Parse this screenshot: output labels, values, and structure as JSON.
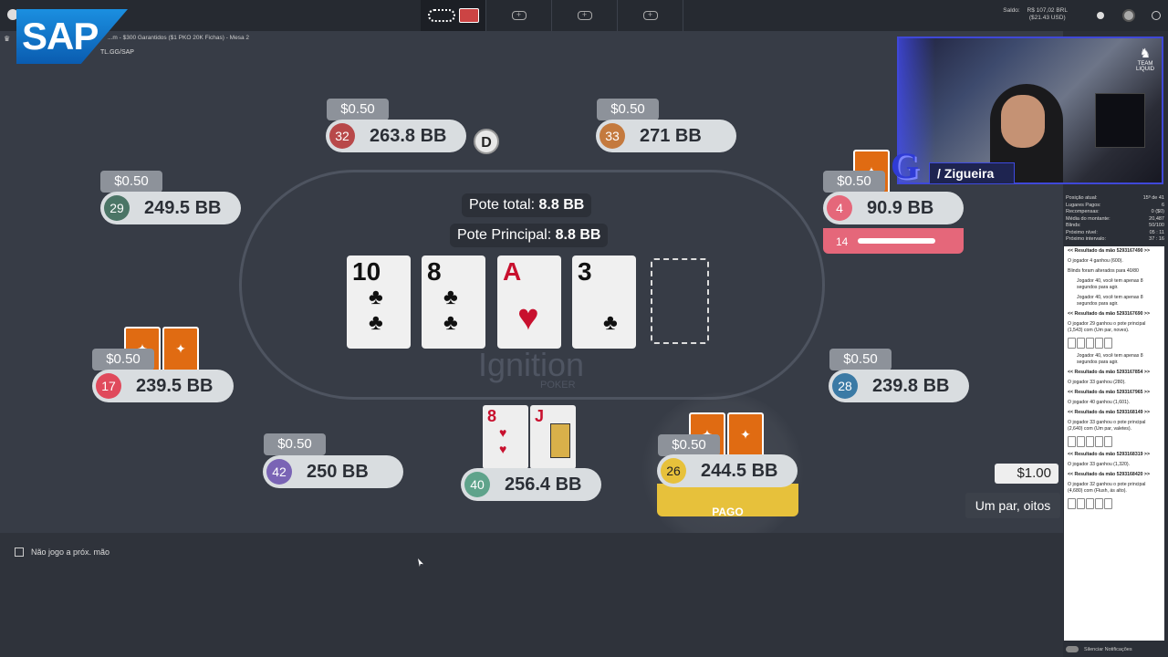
{
  "header": {
    "saldo_label": "Saldo:",
    "saldo_brl": "R$ 107,02 BRL",
    "saldo_usd": "($21.43 USD)",
    "table_title": "...m - $300 Garantidos ($1 PKO 20K Fichas) - Mesa 2",
    "brand_tag": "TL.GG/SAP"
  },
  "overlay": {
    "sap_logo": "SAP",
    "streamer_name": "/ Zigueira",
    "team_logo_text": "TEAM LIQUID"
  },
  "table": {
    "brand": "Ignition",
    "brand_sub": "POKER",
    "pot_total_label": "Pote total:",
    "pot_total_value": "8.8 BB",
    "pot_main_label": "Pote Principal:",
    "pot_main_value": "8.8 BB",
    "dealer_label": "D",
    "board": [
      {
        "rank": "10",
        "suit": "clubs",
        "glyph": "♣"
      },
      {
        "rank": "8",
        "suit": "clubs",
        "glyph": "♣"
      },
      {
        "rank": "A",
        "suit": "hearts",
        "glyph": "♥"
      },
      {
        "rank": "3",
        "suit": "clubs",
        "glyph": "♣"
      }
    ]
  },
  "seats": [
    {
      "id": "32",
      "stack": "263.8 BB",
      "bet": "$0.50",
      "color": "#b8494a"
    },
    {
      "id": "33",
      "stack": "271 BB",
      "bet": "$0.50",
      "color": "#c47a3e"
    },
    {
      "id": "29",
      "stack": "249.5 BB",
      "bet": "$0.50",
      "color": "#4b7566"
    },
    {
      "id": "4",
      "stack": "90.9 BB",
      "bet": "$0.50",
      "color": "#e5677a"
    },
    {
      "id": "17",
      "stack": "239.5 BB",
      "bet": "$0.50",
      "color": "#e04a5c"
    },
    {
      "id": "28",
      "stack": "239.8 BB",
      "bet": "$0.50",
      "color": "#3b7aa5"
    },
    {
      "id": "42",
      "stack": "250 BB",
      "bet": "$0.50",
      "color": "#7a64b5"
    },
    {
      "id": "40",
      "stack": "256.4 BB",
      "bet": "",
      "color": "#5fa38b"
    },
    {
      "id": "26",
      "stack": "244.5 BB",
      "bet": "$0.50",
      "color": "#e7c13b"
    }
  ],
  "hero": {
    "hole_cards": [
      {
        "rank": "8",
        "glyph": "♥"
      },
      {
        "rank": "J",
        "glyph": "♥"
      }
    ]
  },
  "timer": {
    "seconds": "14",
    "fraction": 0.85
  },
  "action": {
    "pago_label": "PAGO",
    "bet_amount": "$1.00",
    "hand_description": "Um par, oitos"
  },
  "options": {
    "sit_out_label": "Não jogo a próx. mão"
  },
  "tournament_stats": [
    {
      "label": "Posição atual:",
      "value": "15º de 41"
    },
    {
      "label": "Lugares Pagos:",
      "value": "6"
    },
    {
      "label": "Recompensas:",
      "value": "0 ($0)"
    },
    {
      "label": "Média do montante:",
      "value": "20,487"
    },
    {
      "label": "Blinds:",
      "value": "50/100"
    },
    {
      "label": "Próximo nível:",
      "value": "05 : 11"
    },
    {
      "label": "Próximo intervalo:",
      "value": "37 : 16"
    }
  ],
  "log": [
    {
      "text": "<< Resultado da mão 5293167490 >>",
      "style": "bold"
    },
    {
      "text": "O jogador 4 ganhou (600).",
      "style": "normal"
    },
    {
      "text": "Blinds foram alterados para 40/80",
      "style": "normal"
    },
    {
      "text": "Jogador 40, você tem apenas 8 segundos para agir.",
      "style": "indent"
    },
    {
      "text": "Jogador 40, você tem apenas 8 segundos para agir.",
      "style": "indent"
    },
    {
      "text": "<< Resultado da mão 5293167690 >>",
      "style": "bold"
    },
    {
      "text": "O jogador 29 ganhou o pote principal (1,543) com (Um par, noves).",
      "style": "normal"
    },
    {
      "text": "Jogador 40, você tem apenas 8 segundos para agir.",
      "style": "indent"
    },
    {
      "text": "<< Resultado da mão 5293167854 >>",
      "style": "bold"
    },
    {
      "text": "O jogador 33 ganhou (280).",
      "style": "normal"
    },
    {
      "text": "<< Resultado da mão 5293167965 >>",
      "style": "bold"
    },
    {
      "text": "O jogador 40 ganhou (1,601).",
      "style": "normal"
    },
    {
      "text": "<< Resultado da mão 5293168149 >>",
      "style": "bold"
    },
    {
      "text": "O jogador 33 ganhou o pote principal (2,640) com (Um par, valetes).",
      "style": "normal"
    },
    {
      "text": "<< Resultado da mão 5293168319 >>",
      "style": "bold"
    },
    {
      "text": "O jogador 33 ganhou (1,320).",
      "style": "normal"
    },
    {
      "text": "<< Resultado da mão 5293168420 >>",
      "style": "bold"
    },
    {
      "text": "O jogador 32 ganhou o pote principal (4,680) com (Flush, ás alto).",
      "style": "normal"
    }
  ],
  "log_footer": "Silenciar Notificações"
}
